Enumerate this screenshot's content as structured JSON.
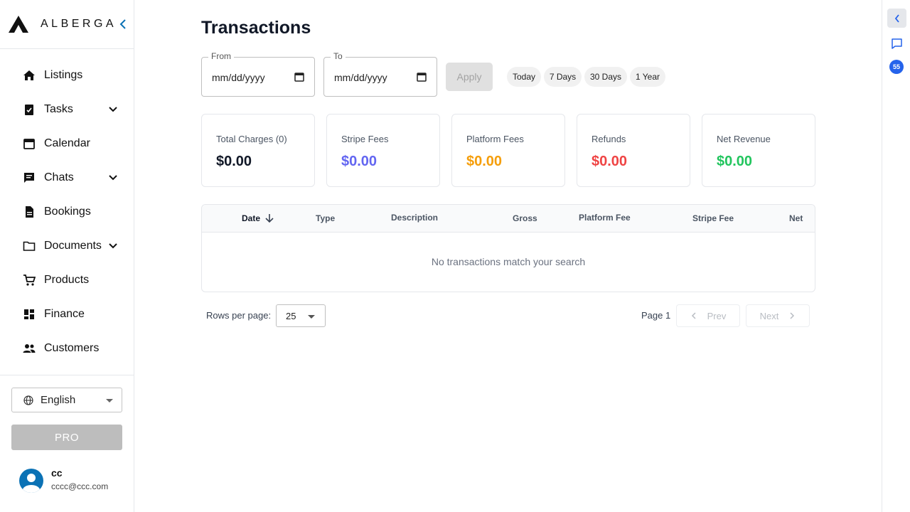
{
  "brand": {
    "name": "ALBERGA"
  },
  "sidebar": {
    "items": [
      {
        "label": "Listings",
        "icon": "home-icon",
        "expandable": false
      },
      {
        "label": "Tasks",
        "icon": "task-icon",
        "expandable": true
      },
      {
        "label": "Calendar",
        "icon": "calendar-icon",
        "expandable": false
      },
      {
        "label": "Chats",
        "icon": "chat-icon",
        "expandable": true
      },
      {
        "label": "Bookings",
        "icon": "document-icon",
        "expandable": false
      },
      {
        "label": "Documents",
        "icon": "folder-icon",
        "expandable": true
      },
      {
        "label": "Products",
        "icon": "cart-icon",
        "expandable": false
      },
      {
        "label": "Finance",
        "icon": "dashboard-icon",
        "expandable": false
      },
      {
        "label": "Customers",
        "icon": "people-icon",
        "expandable": false
      }
    ],
    "language": "English",
    "pro_label": "PRO",
    "user": {
      "name": "cc",
      "email": "cccc@ccc.com"
    }
  },
  "main": {
    "title": "Transactions",
    "filters": {
      "from_label": "From",
      "from_value": "mm/dd/yyyy",
      "to_label": "To",
      "to_value": "mm/dd/yyyy",
      "apply_label": "Apply",
      "quick_ranges": [
        "Today",
        "7 Days",
        "30 Days",
        "1 Year"
      ]
    },
    "summary": [
      {
        "label": "Total Charges (0)",
        "value": "$0.00",
        "color": "#111827"
      },
      {
        "label": "Stripe Fees",
        "value": "$0.00",
        "color": "#6366f1"
      },
      {
        "label": "Platform Fees",
        "value": "$0.00",
        "color": "#f59e0b"
      },
      {
        "label": "Refunds",
        "value": "$0.00",
        "color": "#ef4444"
      },
      {
        "label": "Net Revenue",
        "value": "$0.00",
        "color": "#22c55e"
      }
    ],
    "table": {
      "columns": [
        "Date",
        "Type",
        "Description",
        "Gross",
        "Platform Fee",
        "Stripe Fee",
        "Net"
      ],
      "empty_message": "No transactions match your search"
    },
    "pagination": {
      "rows_label": "Rows per page:",
      "rows_value": "25",
      "page_label": "Page 1",
      "prev_label": "Prev",
      "next_label": "Next"
    }
  },
  "rail": {
    "badge": "55"
  },
  "colors": {
    "accent": "#2563eb",
    "brand_blue": "#0b72b5"
  }
}
